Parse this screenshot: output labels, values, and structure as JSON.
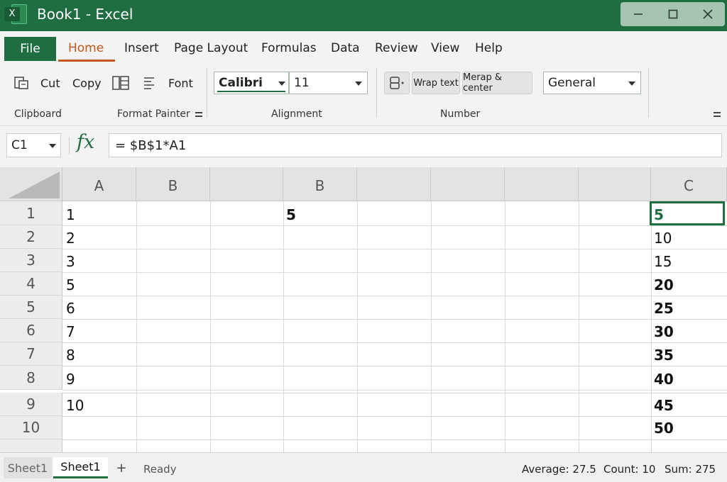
{
  "window": {
    "title": "Book1 - Excel",
    "logo_letter": "X",
    "controls": [
      "minimize-icon",
      "maximize-icon",
      "close-icon"
    ]
  },
  "menu": {
    "file": "File",
    "items": [
      "Home",
      "Insert",
      "Page Layout",
      "Formulas",
      "Data",
      "Review",
      "View",
      "Help"
    ],
    "active": "Home"
  },
  "ribbon": {
    "cut": "Cut",
    "copy": "Copy",
    "font": "Font",
    "clipboard_label": "Clipboard",
    "format_painter_label": "Format Painter",
    "font_name": "Calibri",
    "font_size": "11",
    "alignment_label": "Alignment",
    "wrap_text": "Wrap text",
    "merge_center": "Merap & center",
    "number_label": "Number",
    "number_format": "General"
  },
  "formula_bar": {
    "name_box": "C1",
    "fx": "fx",
    "formula": "= $B$1*A1"
  },
  "grid": {
    "column_headers": [
      "A",
      "B",
      "",
      "B",
      "",
      "",
      "",
      "",
      "C"
    ],
    "row_headers": [
      "1",
      "2",
      "3",
      "4",
      "5",
      "6",
      "7",
      "8",
      "9",
      "10"
    ],
    "col_a": [
      "1",
      "2",
      "3",
      "5",
      "6",
      "7",
      "8",
      "9",
      "10",
      ""
    ],
    "b1": "5",
    "col_c": [
      "5",
      "10",
      "15",
      "20",
      "25",
      "30",
      "35",
      "40",
      "45",
      "50"
    ],
    "selected_cell": "C1"
  },
  "status_bar": {
    "tabs": [
      "Sheet1",
      "Sheet1"
    ],
    "active_tab_index": 1,
    "add_sheet": "+",
    "mode": "Ready",
    "average": "Average: 27.5",
    "count": "Count: 10",
    "sum": "Sum: 275"
  },
  "colors": {
    "brand_green": "#1e6e42",
    "home_accent": "#c4581f"
  }
}
